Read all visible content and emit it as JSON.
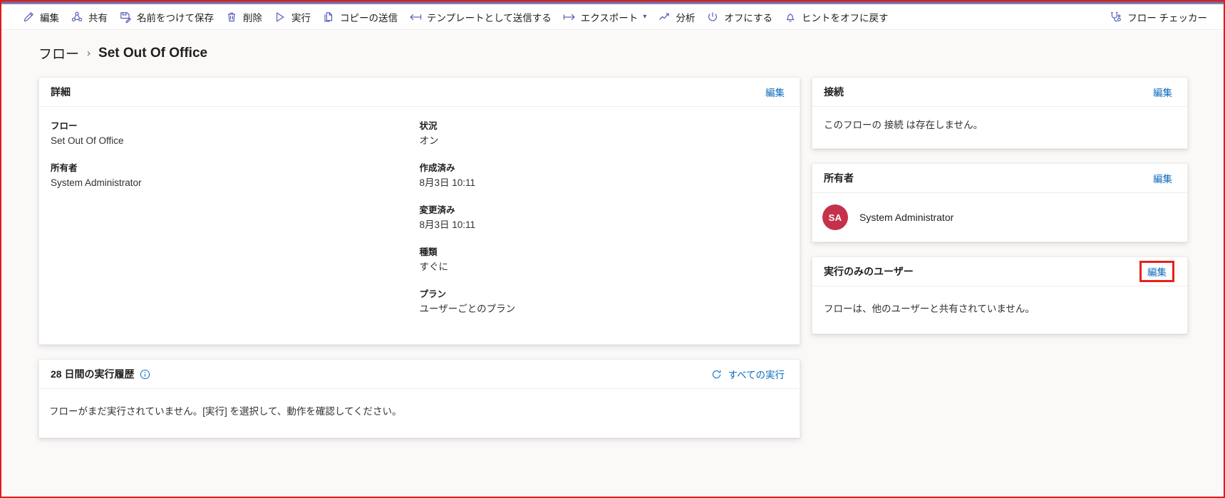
{
  "commandbar": {
    "items": [
      {
        "icon": "pencil-icon",
        "label": "編集",
        "caret": false
      },
      {
        "icon": "share-icon",
        "label": "共有",
        "caret": false
      },
      {
        "icon": "save-as-icon",
        "label": "名前をつけて保存",
        "caret": false
      },
      {
        "icon": "trash-icon",
        "label": "削除",
        "caret": false
      },
      {
        "icon": "play-icon",
        "label": "実行",
        "caret": false
      },
      {
        "icon": "copy-icon",
        "label": "コピーの送信",
        "caret": false
      },
      {
        "icon": "send-template-icon",
        "label": "テンプレートとして送信する",
        "caret": false
      },
      {
        "icon": "export-icon",
        "label": "エクスポート",
        "caret": true
      },
      {
        "icon": "analytics-icon",
        "label": "分析",
        "caret": false
      },
      {
        "icon": "power-icon",
        "label": "オフにする",
        "caret": false
      },
      {
        "icon": "bell-icon",
        "label": "ヒントをオフに戻す",
        "caret": false
      }
    ],
    "right_item": {
      "icon": "flow-checker-icon",
      "label": "フロー チェッカー"
    }
  },
  "breadcrumb": {
    "root": "フロー",
    "separator": "›",
    "current": "Set Out Of Office"
  },
  "details_card": {
    "title": "詳細",
    "edit_label": "編集",
    "left_fields": [
      {
        "label": "フロー",
        "value": "Set Out Of Office"
      },
      {
        "label": "所有者",
        "value": "System Administrator"
      }
    ],
    "right_fields": [
      {
        "label": "状況",
        "value": "オン"
      },
      {
        "label": "作成済み",
        "value": "8月3日 10:11"
      },
      {
        "label": "変更済み",
        "value": "8月3日 10:11"
      },
      {
        "label": "種類",
        "value": "すぐに"
      },
      {
        "label": "プラン",
        "value": "ユーザーごとのプラン"
      }
    ]
  },
  "run_history_card": {
    "title": "28 日間の実行履歴",
    "info_icon": "info-icon",
    "all_runs_label": "すべての実行",
    "all_runs_icon": "refresh-icon",
    "empty_text": "フローがまだ実行されていません。[実行] を選択して、動作を確認してください。"
  },
  "connections_card": {
    "title": "接続",
    "edit_label": "編集",
    "empty_text": "このフローの 接続 は存在しません。"
  },
  "owners_card": {
    "title": "所有者",
    "edit_label": "編集",
    "owner": {
      "initials": "SA",
      "name": "System Administrator",
      "avatar_color": "#c4314b"
    }
  },
  "run_only_users_card": {
    "title": "実行のみのユーザー",
    "edit_label": "編集",
    "edit_highlighted": true,
    "highlight_color": "#e5231b",
    "empty_text": "フローは、他のユーザーと共有されていません。"
  },
  "colors": {
    "accent": "#4a51b5",
    "link": "#0f6cbd",
    "page_background": "#faf9f8",
    "card_background": "#ffffff",
    "avatar": "#c4314b",
    "highlight_border": "#e5231b",
    "top_strip": "#8b82b4"
  }
}
